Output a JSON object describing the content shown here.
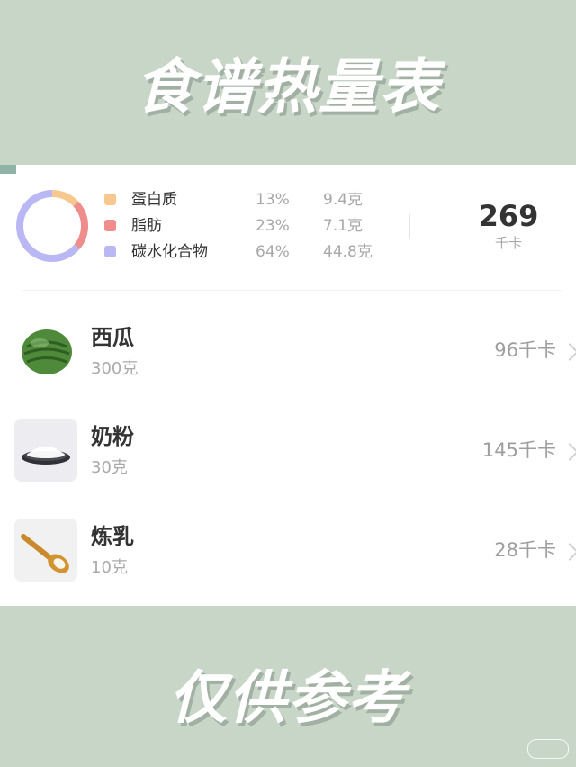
{
  "title": "食谱热量表",
  "footer": "仅供参考",
  "colors": {
    "background": "#c8d6c8",
    "protein": "#f6c890",
    "fat": "#ef8c8c",
    "carbs": "#b9b8f4"
  },
  "nutrition": {
    "macros": [
      {
        "name": "蛋白质",
        "percent": "13%",
        "grams": "9.4克",
        "share": 0.13
      },
      {
        "name": "脂肪",
        "percent": "23%",
        "grams": "7.1克",
        "share": 0.23
      },
      {
        "name": "碳水化合物",
        "percent": "64%",
        "grams": "44.8克",
        "share": 0.64
      }
    ],
    "total_value": "269",
    "total_unit": "千卡"
  },
  "foods": [
    {
      "name": "西瓜",
      "amount": "300克",
      "calories": "96千卡",
      "icon": "watermelon-icon"
    },
    {
      "name": "奶粉",
      "amount": "30克",
      "calories": "145千卡",
      "icon": "milk-powder-icon"
    },
    {
      "name": "炼乳",
      "amount": "10克",
      "calories": "28千卡",
      "icon": "condensed-milk-spoon-icon"
    }
  ]
}
